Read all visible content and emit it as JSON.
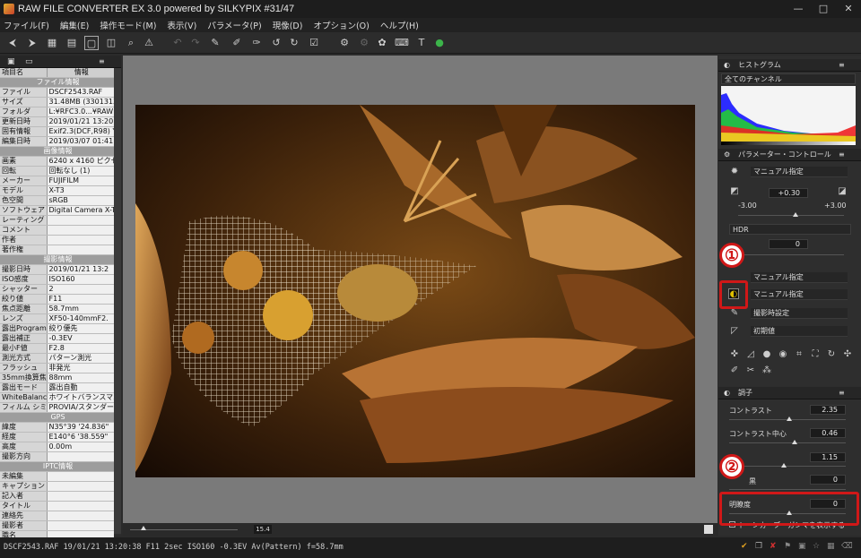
{
  "title": "RAW FILE CONVERTER EX 3.0 powered by SILKYPIX  #31/47",
  "menu": [
    "ファイル(F)",
    "編集(E)",
    "操作モード(M)",
    "表示(V)",
    "パラメータ(P)",
    "現像(D)",
    "オプション(O)",
    "ヘルプ(H)"
  ],
  "info_panel": {
    "col_key": "項目名",
    "col_val": "情報",
    "rows": [
      {
        "section": "ファイル情報"
      },
      {
        "k": "ファイル",
        "v": "DSCF2543.RAF"
      },
      {
        "k": "サイズ",
        "v": "31.48MB (3301313"
      },
      {
        "k": "フォルダ",
        "v": "L:¥RFC3.0...¥RAW"
      },
      {
        "k": "更新日時",
        "v": "2019/01/21 13:20:"
      },
      {
        "k": "固有情報",
        "v": "Exif2.3(DCF,R98) Y"
      },
      {
        "k": "編集日時",
        "v": "2019/03/07 01:41:"
      },
      {
        "section": "画像情報"
      },
      {
        "k": "画素",
        "v": "6240 x 4160 ピクセル"
      },
      {
        "k": "回転",
        "v": "回転なし (1)"
      },
      {
        "k": "メーカー",
        "v": "FUJIFILM"
      },
      {
        "k": "モデル",
        "v": "X-T3"
      },
      {
        "k": "色空間",
        "v": "sRGB"
      },
      {
        "k": "ソフトウェア",
        "v": "Digital Camera X-T"
      },
      {
        "k": "レーティング",
        "v": ""
      },
      {
        "k": "コメント",
        "v": ""
      },
      {
        "k": "作者",
        "v": ""
      },
      {
        "k": "著作権",
        "v": ""
      },
      {
        "section": "撮影情報"
      },
      {
        "k": "撮影日時",
        "v": "2019/01/21 13:2"
      },
      {
        "k": "ISO感度",
        "v": "ISO160"
      },
      {
        "k": "シャッター",
        "v": "2"
      },
      {
        "k": "絞り値",
        "v": "F11"
      },
      {
        "k": "焦点距離",
        "v": "58.7mm"
      },
      {
        "k": "レンズ",
        "v": "XF50-140mmF2."
      },
      {
        "k": "露出Program",
        "v": "絞り優先"
      },
      {
        "k": "露出補正",
        "v": "-0.3EV"
      },
      {
        "k": "最小F値",
        "v": "F2.8"
      },
      {
        "k": "測光方式",
        "v": "パターン測光"
      },
      {
        "k": "フラッシュ",
        "v": "非発光"
      },
      {
        "k": "35mm換算焦点",
        "v": "88mm"
      },
      {
        "k": "露出モード",
        "v": "露出自動"
      },
      {
        "k": "WhiteBalance",
        "v": "ホワイトバランスマニュア"
      },
      {
        "k": "フィルム シミュレー",
        "v": "PROVIA/スタンダード"
      },
      {
        "section": "GPS"
      },
      {
        "k": "緯度",
        "v": "N35°39 '24.836\""
      },
      {
        "k": "経度",
        "v": "E140°6 '38.559\""
      },
      {
        "k": "高度",
        "v": "0.00m"
      },
      {
        "k": "撮影方向",
        "v": ""
      },
      {
        "section": "IPTC情報"
      },
      {
        "k": "未編集",
        "v": ""
      },
      {
        "k": "キャプション",
        "v": ""
      },
      {
        "k": "記入者",
        "v": ""
      },
      {
        "k": "タイトル",
        "v": ""
      },
      {
        "k": "連絡先",
        "v": ""
      },
      {
        "k": "撮影者",
        "v": ""
      },
      {
        "k": "職名",
        "v": ""
      },
      {
        "k": "国",
        "v": ""
      }
    ]
  },
  "status": "DSCF2543.RAF 19/01/21 13:20:38 F11 2sec ISO160 -0.3EV Av(Pattern) f=58.7mm",
  "zoom": "15.4",
  "histogram": {
    "title": "ヒストグラム",
    "channel": "全てのチャンネル"
  },
  "param_control": {
    "title": "パラメーター・コントロール",
    "mode": "マニュアル指定",
    "exposure_value": "+0.30",
    "range_min": "-3.00",
    "range_max": "+3.00",
    "hdr_label": "HDR",
    "hdr_value": "0",
    "wb_mode": "マニュアル指定",
    "tone_mode": "マニュアル指定",
    "sharp_mode": "撮影時設定",
    "noise_mode": "初期値"
  },
  "tone": {
    "title": "調子",
    "contrast_label": "コントラスト",
    "contrast_value": "2.35",
    "contrast_center_label": "コントラスト中心",
    "contrast_center_value": "0.46",
    "gamma_value": "1.15",
    "fourth_label": "黒",
    "fourth_value": "0",
    "clarity_label": "明瞭度",
    "clarity_value": "0",
    "curve_label": "トーンカーブ・ガンマを表示する"
  },
  "callouts": [
    "①",
    "②"
  ],
  "colors": {
    "accent_red": "#d01818",
    "panel": "#2e2e2e",
    "viewer": "#7a7a7a"
  }
}
